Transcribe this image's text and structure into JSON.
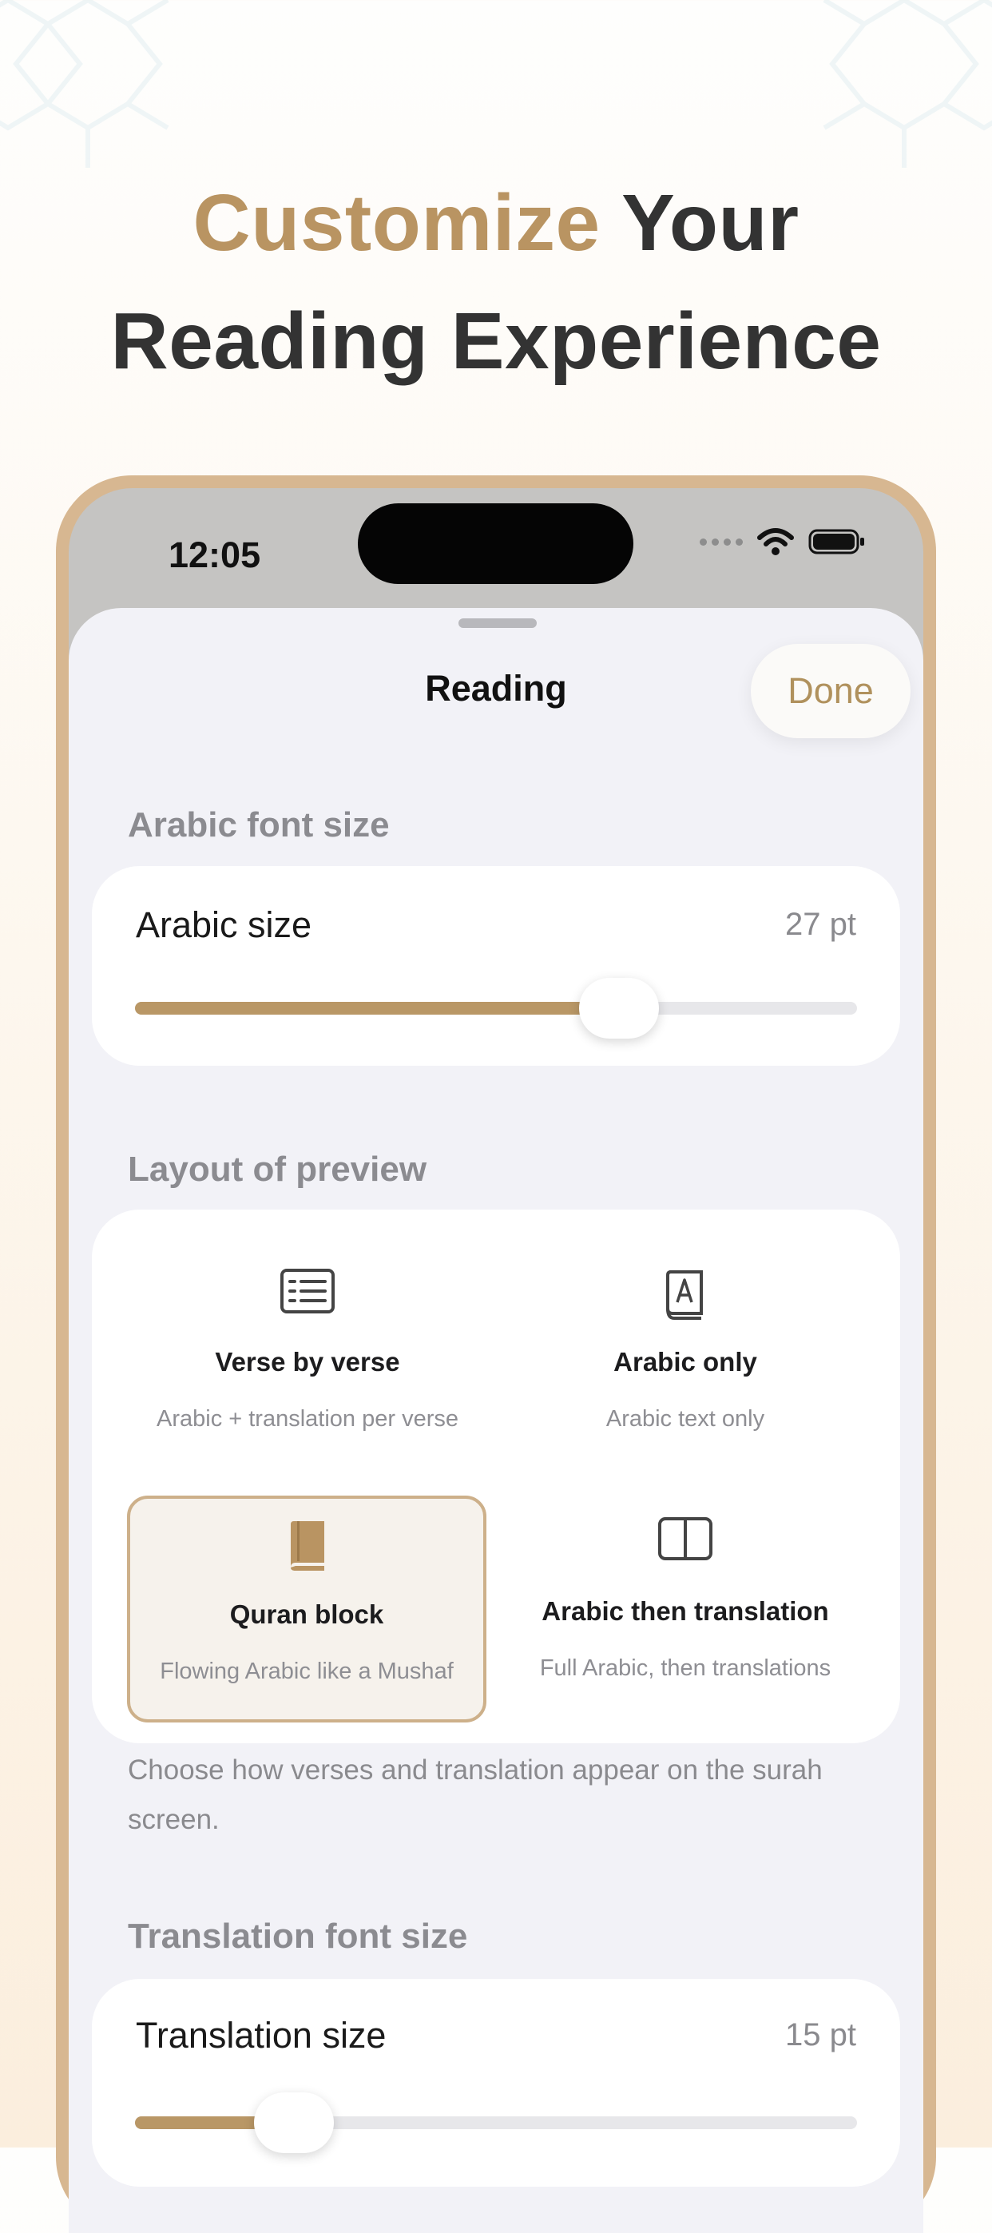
{
  "headline": {
    "accent": "Customize",
    "rest_line1": " Your",
    "line2": "Reading Experience"
  },
  "status_bar": {
    "time": "12:05"
  },
  "sheet": {
    "title": "Reading",
    "done_label": "Done"
  },
  "arabic_font": {
    "section_label": "Arabic font size",
    "row_label": "Arabic size",
    "value": "27 pt",
    "slider_fraction": 0.67
  },
  "layout": {
    "section_label": "Layout of preview",
    "options": [
      {
        "title": "Verse by verse",
        "subtitle": "Arabic + translation per verse",
        "icon": "list-icon",
        "selected": false
      },
      {
        "title": "Arabic only",
        "subtitle": "Arabic text only",
        "icon": "arabic-book-icon",
        "selected": false
      },
      {
        "title": "Quran block",
        "subtitle": "Flowing Arabic like a Mushaf",
        "icon": "book-icon",
        "selected": true
      },
      {
        "title": "Arabic then translation",
        "subtitle": "Full Arabic, then translations",
        "icon": "split-columns-icon",
        "selected": false
      }
    ],
    "footnote": "Choose how verses and translation appear on the surah screen."
  },
  "translation_font": {
    "section_label": "Translation font size",
    "row_label": "Translation size",
    "value": "15 pt",
    "slider_fraction": 0.22
  },
  "colors": {
    "accent": "#b99462",
    "frame": "#d7b791",
    "slider_fill": "#b99766",
    "selected_border": "#cdb08a"
  }
}
